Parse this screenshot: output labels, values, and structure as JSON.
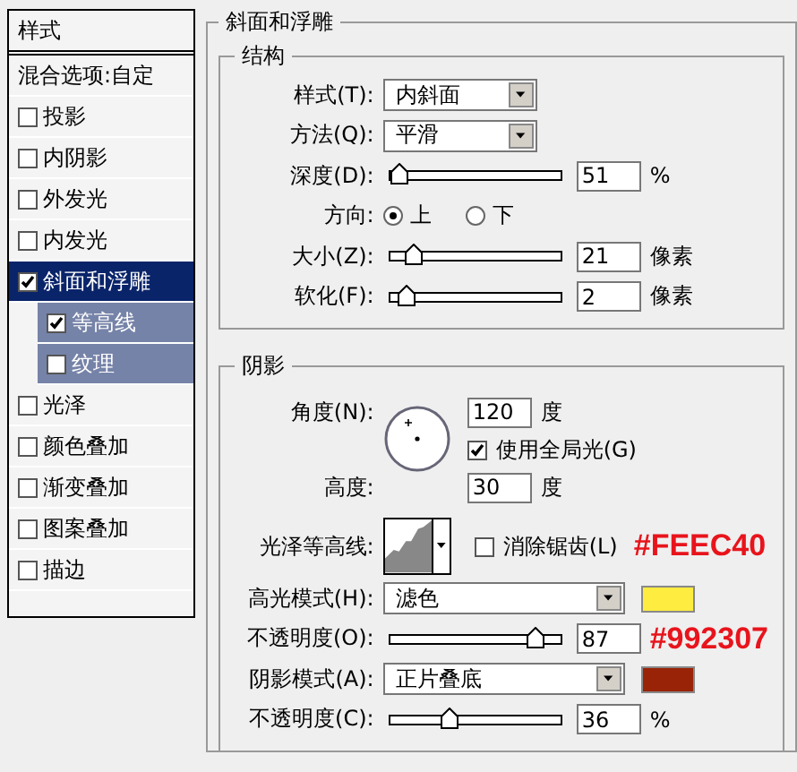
{
  "sidebar": {
    "title": "样式",
    "items": [
      {
        "kind": "plain",
        "label": "混合选项:自定",
        "selected": false
      },
      {
        "kind": "check",
        "label": "投影",
        "checked": false,
        "selected": false
      },
      {
        "kind": "check",
        "label": "内阴影",
        "checked": false,
        "selected": false
      },
      {
        "kind": "check",
        "label": "外发光",
        "checked": false,
        "selected": false
      },
      {
        "kind": "check",
        "label": "内发光",
        "checked": false,
        "selected": false
      },
      {
        "kind": "check",
        "label": "斜面和浮雕",
        "checked": true,
        "selected": true,
        "children": [
          {
            "kind": "check",
            "label": "等高线",
            "checked": true,
            "selected": false
          },
          {
            "kind": "check",
            "label": "纹理",
            "checked": false,
            "selected": false
          }
        ]
      },
      {
        "kind": "check",
        "label": "光泽",
        "checked": false,
        "selected": false
      },
      {
        "kind": "check",
        "label": "颜色叠加",
        "checked": false,
        "selected": false
      },
      {
        "kind": "check",
        "label": "渐变叠加",
        "checked": false,
        "selected": false
      },
      {
        "kind": "check",
        "label": "图案叠加",
        "checked": false,
        "selected": false
      },
      {
        "kind": "check",
        "label": "描边",
        "checked": false,
        "selected": false
      }
    ]
  },
  "panel": {
    "title": "斜面和浮雕",
    "structure": {
      "title": "结构",
      "rows": [
        {
          "kind": "dropdown",
          "label": "样式(T):",
          "value": "内斜面"
        },
        {
          "kind": "dropdown",
          "label": "方法(Q):",
          "value": "平滑"
        },
        {
          "kind": "slider",
          "label": "深度(D):",
          "level": 0.05,
          "value": "51",
          "unit": "%"
        },
        {
          "kind": "radio",
          "label": "方向:",
          "options": [
            {
              "label": "上",
              "selected": true
            },
            {
              "label": "下",
              "selected": false
            }
          ]
        },
        {
          "kind": "slider",
          "label": "大小(Z):",
          "level": 0.14,
          "value": "21",
          "unit": "像素"
        },
        {
          "kind": "slider",
          "label": "软化(F):",
          "level": 0.1,
          "value": "2",
          "unit": "像素"
        }
      ]
    },
    "shading": {
      "title": "阴影",
      "angle": {
        "label": "角度(N):",
        "value": "120",
        "unit": "度"
      },
      "global_light": {
        "label": "使用全局光(G)",
        "checked": true
      },
      "altitude": {
        "label": "高度:",
        "value": "30",
        "unit": "度"
      },
      "gloss_contour": {
        "label": "光泽等高线:",
        "anti_alias": {
          "label": "消除锯齿(L)",
          "checked": false
        },
        "annotation": "#FEEC40"
      },
      "rows": [
        {
          "kind": "mode",
          "label": "高光模式(H):",
          "value": "滤色",
          "color": "#feec40"
        },
        {
          "kind": "slider",
          "label": "不透明度(O):",
          "level": 0.85,
          "value": "87",
          "annotation": "#992307"
        },
        {
          "kind": "mode",
          "label": "阴影模式(A):",
          "value": "正片叠底",
          "color": "#992307"
        },
        {
          "kind": "slider",
          "label": "不透明度(C):",
          "level": 0.35,
          "value": "36",
          "unit": "%"
        }
      ]
    }
  }
}
